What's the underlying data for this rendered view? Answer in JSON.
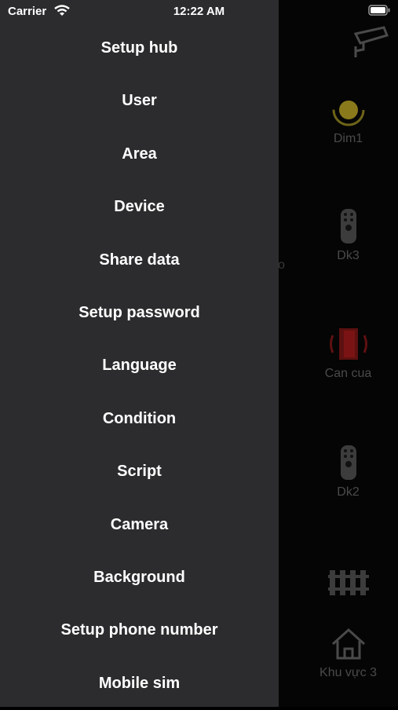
{
  "status_bar": {
    "carrier": "Carrier",
    "time": "12:22 AM",
    "wifi_icon": "wifi-icon",
    "battery_icon": "battery-icon"
  },
  "drawer": {
    "background": "#2c2c2e",
    "items": [
      {
        "label": "Setup hub"
      },
      {
        "label": "User"
      },
      {
        "label": "Area"
      },
      {
        "label": "Device"
      },
      {
        "label": "Share data"
      },
      {
        "label": "Setup password"
      },
      {
        "label": "Language"
      },
      {
        "label": "Condition"
      },
      {
        "label": "Script"
      },
      {
        "label": "Camera"
      },
      {
        "label": "Background"
      },
      {
        "label": "Setup phone number"
      },
      {
        "label": "Mobile sim"
      }
    ]
  },
  "background_screen": {
    "camera_icon": "security-camera-icon",
    "partial_label": "o",
    "tiles": [
      {
        "label": "Dim1",
        "icon": "dimmer-icon",
        "icon_color": "#8a7a1c"
      },
      {
        "label": "Dk3",
        "icon": "remote-control-icon"
      },
      {
        "label": "Can cua",
        "icon": "door-icon",
        "icon_color": "#7a1414"
      },
      {
        "label": "Dk2",
        "icon": "remote-control-icon"
      },
      {
        "label": "",
        "icon": "fence-icon"
      },
      {
        "label": "Khu vực 3",
        "icon": "home-icon"
      }
    ]
  }
}
